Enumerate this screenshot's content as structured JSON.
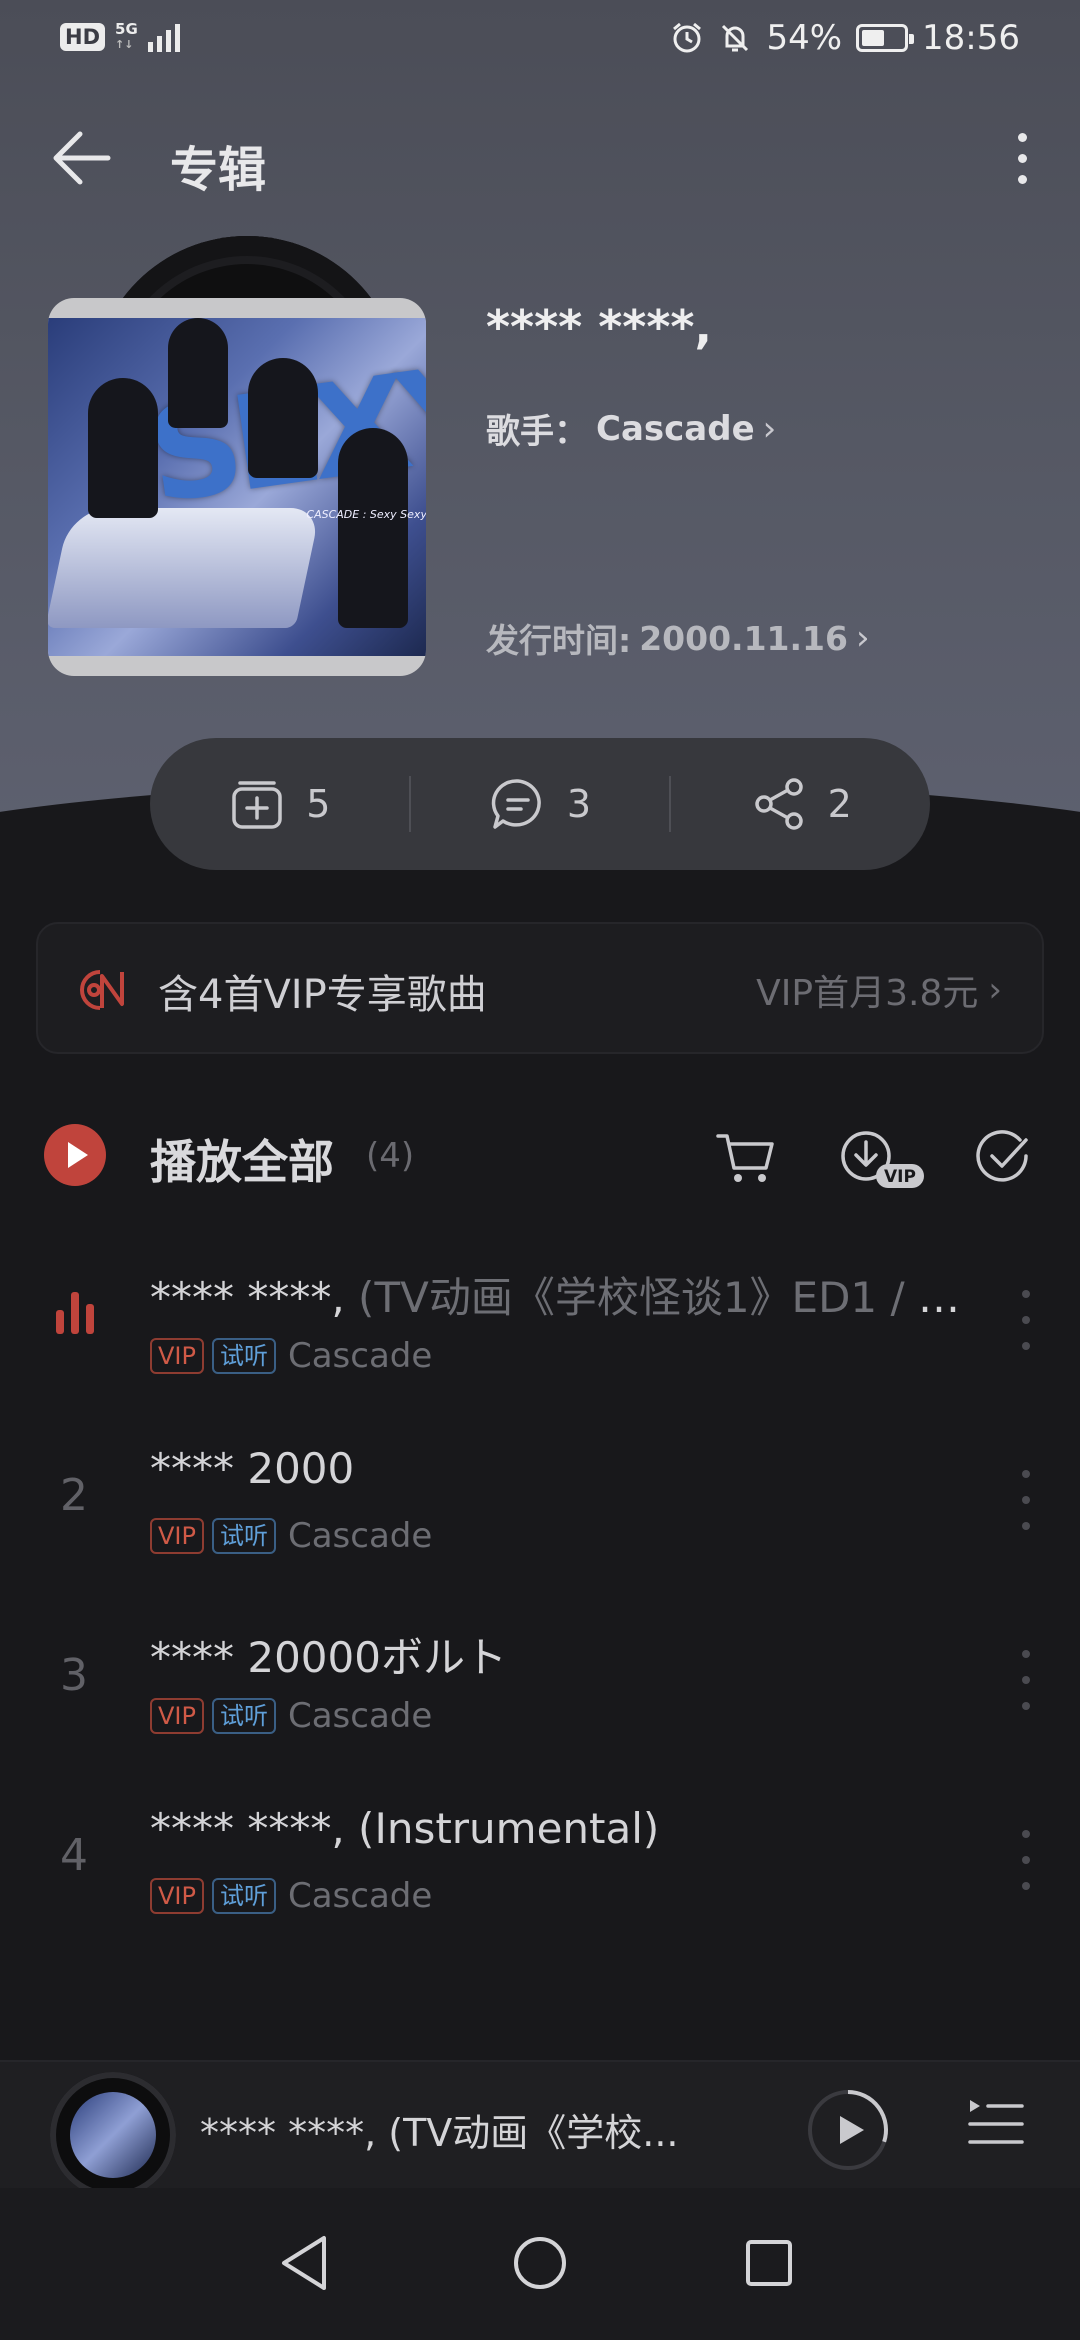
{
  "status_bar": {
    "hd": "HD",
    "network": "5G",
    "network_sub": "↑↓",
    "battery": "54%",
    "battery_level": 0.54,
    "time": "18:56"
  },
  "header": {
    "title": "专辑"
  },
  "album": {
    "name": "**** ****,",
    "artist_prefix": "歌手：",
    "artist": "Cascade",
    "release_label": "发行时间:",
    "release_date": "2000.11.16",
    "cover_text": "CASCADE : Sexy Sexy."
  },
  "actions": {
    "collect_count": "5",
    "comment_count": "3",
    "share_count": "2"
  },
  "vip_banner": {
    "text": "含4首VIP专享歌曲",
    "offer": "VIP首月3.8元"
  },
  "play_all": {
    "label": "播放全部",
    "count": "(4)",
    "download_badge": "VIP"
  },
  "songs": [
    {
      "index": "1",
      "title": "**** ****,",
      "subtitle": " (TV动画《学校怪谈1》ED1 / T...",
      "vip": "VIP",
      "trial": "试听",
      "artist": "Cascade",
      "playing": true
    },
    {
      "index": "2",
      "title": "**** 2000",
      "subtitle": "",
      "vip": "VIP",
      "trial": "试听",
      "artist": "Cascade",
      "playing": false
    },
    {
      "index": "3",
      "title": "**** 20000ボルト",
      "subtitle": "",
      "vip": "VIP",
      "trial": "试听",
      "artist": "Cascade",
      "playing": false
    },
    {
      "index": "4",
      "title": "**** ****, (Instrumental)",
      "subtitle": "",
      "vip": "VIP",
      "trial": "试听",
      "artist": "Cascade",
      "playing": false
    }
  ],
  "mini_player": {
    "title": "**** ****, (TV动画《学校...",
    "progress": 0.3
  },
  "colors": {
    "accent": "#c0443c",
    "trial_tag": "#5f9fd9"
  }
}
